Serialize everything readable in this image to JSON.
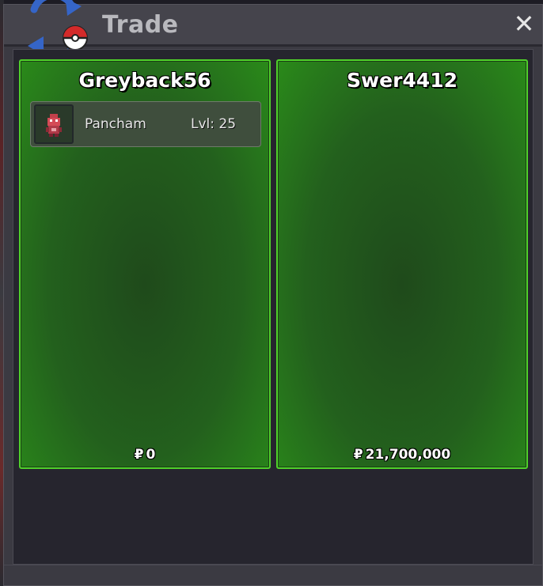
{
  "window": {
    "title": "Trade",
    "close_symbol": "✕",
    "logo_icon": "trade-swap-pokeball-icon"
  },
  "trade": {
    "left_panel": {
      "player_name": "Greyback56",
      "money_symbol": "₽",
      "money": "0",
      "items": [
        {
          "name": "Pancham",
          "level_label": "Lvl: 25",
          "icon": "pancham-sprite-icon"
        }
      ]
    },
    "right_panel": {
      "player_name": "Swer4412",
      "money_symbol": "₽",
      "money": "21,700,000",
      "items": []
    }
  },
  "colors": {
    "panel_border": "#4fd12a",
    "panel_fill": "#23601d",
    "window_bg": "#3b3a42",
    "content_bg": "#26252e"
  }
}
